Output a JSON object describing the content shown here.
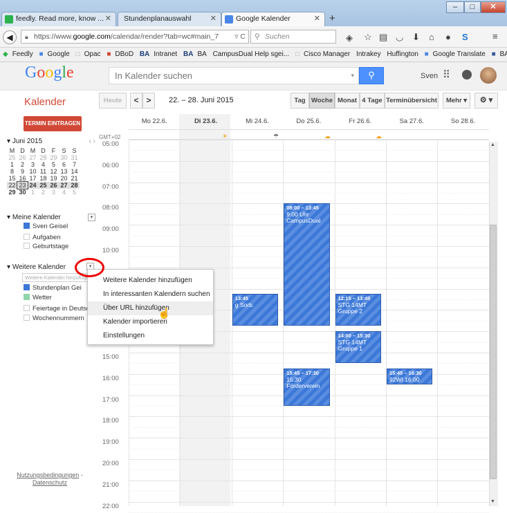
{
  "browser": {
    "tabs": [
      {
        "title": "feedly. Read more, know ..."
      },
      {
        "title": "Stundenplanauswahl"
      },
      {
        "title": "Google Kalender"
      }
    ],
    "url_prefix": "https://www.",
    "url_domain": "google.com",
    "url_rest": "/calendar/render?tab=wc#main_7",
    "search_placeholder": "Suchen",
    "bookmarks": [
      "Feedly",
      "Google",
      "Opac",
      "DBoD",
      "Intranet",
      "BA",
      "CampusDual Help sgei...",
      "Cisco Manager",
      "Intrakey",
      "Huffington",
      "Google Translate",
      "BA Facebook"
    ]
  },
  "google": {
    "logo": "Google",
    "search_placeholder": "In Kalender suchen",
    "user": "Sven"
  },
  "toolbar": {
    "title": "Kalender",
    "today": "Heute",
    "prev": "<",
    "next": ">",
    "date_range": "22. – 28. Juni 2015",
    "views": [
      "Tag",
      "Woche",
      "Monat",
      "4 Tage",
      "Terminübersicht"
    ],
    "more": "Mehr ▾",
    "settings": "⚙ ▾"
  },
  "sidebar": {
    "create_button": "TERMIN EINTRAGEN",
    "minical": {
      "title": "Juni 2015",
      "nav": "‹  ›",
      "weekdays": [
        "M",
        "D",
        "M",
        "D",
        "F",
        "S",
        "S"
      ],
      "weeks": [
        [
          "25",
          "26",
          "27",
          "28",
          "29",
          "30",
          "31"
        ],
        [
          "1",
          "2",
          "3",
          "4",
          "5",
          "6",
          "7"
        ],
        [
          "8",
          "9",
          "10",
          "11",
          "12",
          "13",
          "14"
        ],
        [
          "15",
          "16",
          "17",
          "18",
          "19",
          "20",
          "21"
        ],
        [
          "22",
          "23",
          "24",
          "25",
          "26",
          "27",
          "28"
        ],
        [
          "29",
          "30",
          "1",
          "2",
          "3",
          "4",
          "5"
        ]
      ]
    },
    "my_calendars": {
      "title": "Meine Kalender",
      "items": [
        {
          "label": "Sven Geisel",
          "color": "#3c78d8"
        },
        {
          "label": "Aufgaben",
          "color": ""
        },
        {
          "label": "Geburtstage",
          "color": ""
        }
      ]
    },
    "other_calendars": {
      "title": "Weitere Kalender",
      "add_placeholder": "Weitere Kalender hinzufügen",
      "items": [
        {
          "label": "Stundenplan Gei",
          "color": "#3c78d8"
        },
        {
          "label": "Wetter",
          "color": "#8ed6a8"
        },
        {
          "label": "Feiertage in Deutsch",
          "color": ""
        },
        {
          "label": "Wochennummern",
          "color": ""
        }
      ]
    },
    "footer_terms": "Nutzungsbedingungen",
    "footer_sep": " -",
    "footer_privacy": "Datenschutz"
  },
  "calendar": {
    "timezone": "GMT+02",
    "days": [
      "Mo 22.6.",
      "Di 23.6.",
      "Mi 24.6.",
      "Do 25.6.",
      "Fr 26.6.",
      "Sa 27.6.",
      "So 28.6."
    ],
    "hours": [
      "05:00",
      "06:00",
      "07:00",
      "08:00",
      "09:00",
      "10:00",
      "11:00",
      "12:00",
      "13:00",
      "14:00",
      "15:00",
      "16:00",
      "17:00",
      "18:00",
      "19:00",
      "20:00",
      "21:00",
      "22:00"
    ],
    "events": [
      {
        "day": 3,
        "start": 8.0,
        "end": 13.75,
        "time": "08:00 – 13:45",
        "title": "9:00 Uhr CampusDual"
      },
      {
        "day": 2,
        "start": 12.25,
        "end": 13.75,
        "time": "13:45",
        "title": "g Sorb."
      },
      {
        "day": 4,
        "start": 12.25,
        "end": 13.75,
        "time": "12:15 – 13:45",
        "title": "STG 14MT Gruppe 2"
      },
      {
        "day": 4,
        "start": 14.0,
        "end": 15.5,
        "time": "14:00 – 15:30",
        "title": "STG 14MT Gruppe 1"
      },
      {
        "day": 3,
        "start": 15.75,
        "end": 17.5,
        "time": "15:45 – 17:30",
        "title": "15:30 Förderverein"
      },
      {
        "day": 5,
        "start": 15.75,
        "end": 16.5,
        "time": "15:45 – 16:30",
        "title": "92WI 16:00"
      }
    ]
  },
  "context_menu": {
    "items": [
      "Weitere Kalender hinzufügen",
      "In interessanten Kalendern suchen",
      "Über URL hinzufügen",
      "Kalender importieren",
      "Einstellungen"
    ]
  }
}
